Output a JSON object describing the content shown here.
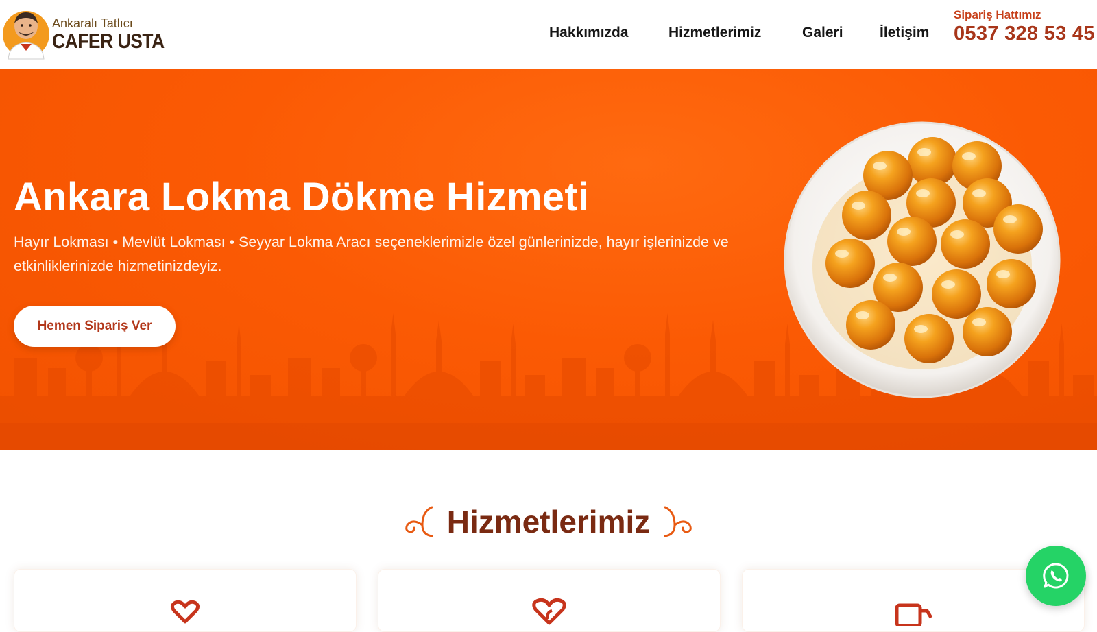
{
  "brand": {
    "small_text": "Ankaralı Tatlıcı",
    "name": "CAFER USTA",
    "mascot_icon": "chef-mascot-icon"
  },
  "nav": {
    "items": [
      {
        "label": "Hakkımızda"
      },
      {
        "label": "Hizmetlerimiz"
      },
      {
        "label": "Galeri"
      },
      {
        "label": "İletişim"
      }
    ]
  },
  "order_line": {
    "label": "Sipariş Hattımız",
    "phone": "0537 328 53 45"
  },
  "hero": {
    "title": "Ankara Lokma Dökme Hizmeti",
    "subtitle": "Hayır Lokması • Mevlüt Lokması • Seyyar Lokma Aracı seçeneklerimizle özel günlerinizde, hayır işlerinizde ve etkinliklerinizde hizmetinizdeyiz.",
    "cta_label": "Hemen Sipariş Ver",
    "image": "lokma-plate-image",
    "background": "istanbul-skyline-silhouette"
  },
  "services": {
    "title": "Hizmetlerimiz",
    "cards": [
      {
        "icon": "heart-hands-icon"
      },
      {
        "icon": "heart-crescent-icon"
      },
      {
        "icon": "food-truck-icon"
      }
    ]
  },
  "whatsapp": {
    "icon": "whatsapp-icon"
  },
  "colors": {
    "accent": "#fb5a04",
    "heading_brown": "#7a2a12",
    "phone_red": "#a8361a",
    "whatsapp_green": "#25d366"
  }
}
